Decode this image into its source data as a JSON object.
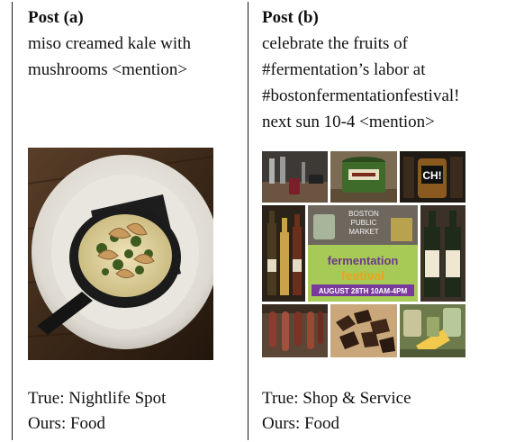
{
  "posts": [
    {
      "title": "Post (a)",
      "text_lines": [
        "miso creamed kale with",
        "mushrooms <mention>"
      ],
      "true_label": "True: Nightlife Spot",
      "ours_label": "Ours: Food",
      "image_icon": "skillet-dish-photo"
    },
    {
      "title": "Post (b)",
      "text_lines": [
        "celebrate the fruits of",
        "#fermentation’s labor at",
        "#bostonfermentationfestival!",
        "next sun 10-4 <mention>"
      ],
      "true_label": "True: Shop & Service",
      "ours_label": "Ours: Food",
      "image_icon": "photo-collage",
      "collage_sign": {
        "line1": "BOSTON",
        "line2": "PUBLIC",
        "line3": "MARKET"
      },
      "collage_banner": {
        "line1": "fermentation",
        "line2": "festival",
        "date": "AUGUST 28TH 10AM-4PM"
      },
      "collage_jar": "CH!"
    }
  ],
  "colors": {
    "text": "#111111",
    "rule": "#1a1a1a",
    "banner_green": "#9bc43a",
    "banner_orange": "#f0a21e",
    "banner_purple": "#7a3a9c"
  }
}
